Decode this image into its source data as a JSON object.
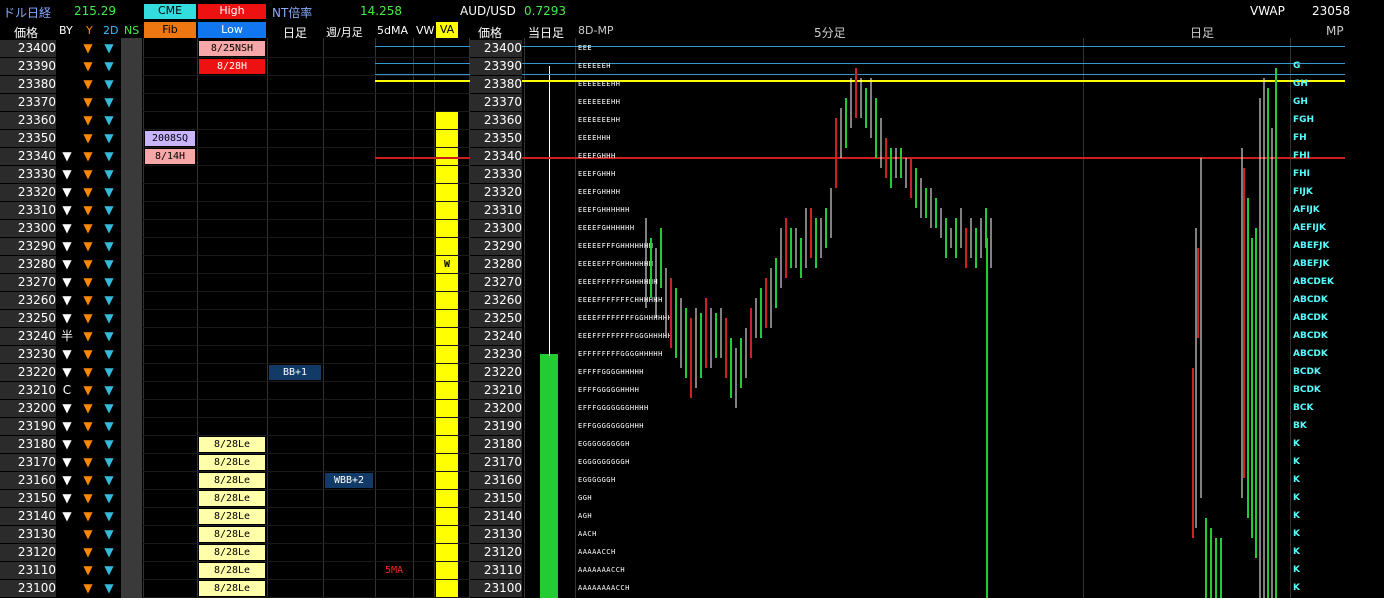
{
  "header": {
    "dollar_nikkei_label": "ドル日経",
    "dollar_nikkei_value": "215.29",
    "cme_label": "CME",
    "high_label": "High",
    "fib_label": "Fib",
    "low_label": "Low",
    "nt_label": "NT倍率",
    "nt_value": "14.258",
    "audusd_label": "AUD/USD",
    "audusd_value": "0.7293",
    "vwap_label": "VWAP",
    "vwap_value": "23058"
  },
  "columns": {
    "price": "価格",
    "by": "BY",
    "y": "Y",
    "d2": "2D",
    "ns": "NS",
    "daily": "日足",
    "weekly_monthly": "週/月足",
    "ma5": "5dMA",
    "vw": "VW",
    "va": "VA",
    "price2": "価格",
    "today": "当日足",
    "mp8d": "8D-MP",
    "min5": "5分足",
    "daily2": "日足",
    "mp": "MP"
  },
  "prices": [
    "23400",
    "23390",
    "23380",
    "23370",
    "23360",
    "23350",
    "23340",
    "23330",
    "23320",
    "23310",
    "23300",
    "23290",
    "23280",
    "23270",
    "23260",
    "23250",
    "23240",
    "23230",
    "23220",
    "23210",
    "23200",
    "23190",
    "23180",
    "23170",
    "23160",
    "23150",
    "23140",
    "23130",
    "23120",
    "23110",
    "23100"
  ],
  "by_marks": [
    "",
    "",
    "",
    "",
    "",
    "",
    "▼",
    "▼",
    "▼",
    "▼",
    "▼",
    "▼",
    "▼",
    "▼",
    "▼",
    "▼",
    "半",
    "▼",
    "▼",
    "C",
    "▼",
    "▼",
    "▼",
    "▼",
    "▼",
    "▼",
    "▼",
    "",
    "",
    "",
    ""
  ],
  "fib_tags": [
    {
      "row": 5,
      "text": "2008SQ"
    },
    {
      "row": 6,
      "text": "8/14H"
    }
  ],
  "low_tags": [
    {
      "row": 0,
      "text": "8/25NSH",
      "kind": "pink"
    },
    {
      "row": 1,
      "text": "8/28H",
      "kind": "red"
    },
    {
      "row": 22,
      "text": "8/28Le",
      "kind": "yellow"
    },
    {
      "row": 23,
      "text": "8/28Le",
      "kind": "yellow"
    },
    {
      "row": 24,
      "text": "8/28Le",
      "kind": "yellow"
    },
    {
      "row": 25,
      "text": "8/28Le",
      "kind": "yellow"
    },
    {
      "row": 26,
      "text": "8/28Le",
      "kind": "yellow"
    },
    {
      "row": 27,
      "text": "8/28Le",
      "kind": "yellow"
    },
    {
      "row": 28,
      "text": "8/28Le",
      "kind": "yellow"
    },
    {
      "row": 29,
      "text": "8/28Le",
      "kind": "yellow"
    },
    {
      "row": 30,
      "text": "8/28Le",
      "kind": "yellow"
    }
  ],
  "daily_tags": [
    {
      "row": 18,
      "text": "BB+1"
    }
  ],
  "weekly_tags": [
    {
      "row": 24,
      "text": "WBB+2"
    }
  ],
  "ma5_tags": [
    {
      "row": 29,
      "text": "5MA"
    }
  ],
  "vw_tags": [
    {
      "row": 12,
      "text": "W"
    }
  ],
  "tpo_profile": [
    "EEE",
    "EEEEEEH",
    "EEEEEEEHH",
    "EEEEEEEHH",
    "EEEEEEEHH",
    "EEEEHHH",
    "EEEFGHHH",
    "EEEFGHHH",
    "EEEFGHHHH",
    "EEEFGHHHHHH",
    "EEEEFGHHHHHH",
    "EEEEEFFFGHHHHHHH",
    "EEEEEFFFGHHHHHHH",
    "EEEEFFFFFFGHHHHHH",
    "EEEEFFFFFFFCHHHHHH",
    "EEEEFFFFFFFFGGHHHHHH",
    "EEEFFFFFFFFFGGGHHHHH",
    "EFFFFFFFFGGGGHHHHH",
    "EFFFFGGGGHHHHH",
    "EFFFGGGGGHHHH",
    "EFFFGGGGGGGHHHH",
    "EFFGGGGGGGGHHH",
    "EGGGGGGGGGH",
    "EGGGGGGGGGH",
    "EGGGGGGH",
    "GGH",
    "AGH",
    "AACH",
    "AAAAACCH",
    "AAAAAAACCH",
    "AAAAAAAACCH"
  ],
  "mp_profile": [
    "",
    "G",
    "GH",
    "GH",
    "FGH",
    "FH",
    "FHI",
    "FHI",
    "FIJK",
    "AFIJK",
    "AEFIJK",
    "ABEFJK",
    "ABEFJK",
    "ABCDEK",
    "ABCDK",
    "ABCDK",
    "ABCDK",
    "ABCDK",
    "BCDK",
    "BCDK",
    "BCK",
    "BK",
    "K",
    "K",
    "K",
    "K",
    "K",
    "K",
    "K",
    "K",
    "K"
  ],
  "colors": {
    "va_fill": "#ffff00",
    "today_bar": "#22cc33",
    "yellow_line": "#ffff00",
    "red_line": "#cc2020",
    "blue_line": "#3399cc",
    "cme_bg": "#33dddd",
    "high_bg": "#ee1111",
    "fib_bg": "#ee7711",
    "low_bg": "#1177ee"
  }
}
